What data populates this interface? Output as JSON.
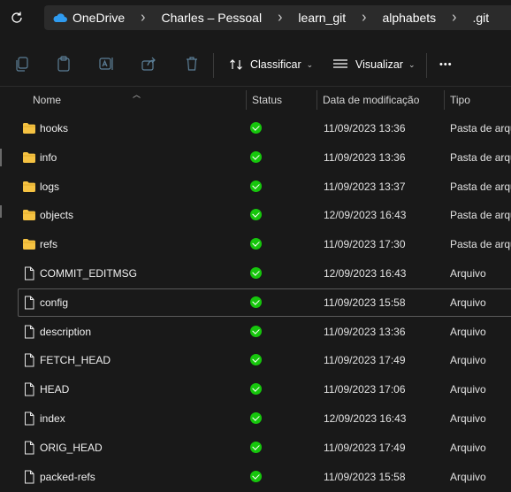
{
  "address_bar": {
    "crumbs": [
      {
        "label": "OneDrive"
      },
      {
        "label": "Charles – Pessoal"
      },
      {
        "label": "learn_git"
      },
      {
        "label": "alphabets"
      },
      {
        "label": ".git"
      }
    ]
  },
  "toolbar": {
    "sort_label": "Classificar",
    "view_label": "Visualizar",
    "more_label": "•••"
  },
  "columns": {
    "name": "Nome",
    "status": "Status",
    "modified": "Data de modificação",
    "type": "Tipo"
  },
  "files": [
    {
      "name": "hooks",
      "kind": "folder",
      "modified": "11/09/2023 13:36",
      "type": "Pasta de arquivos"
    },
    {
      "name": "info",
      "kind": "folder",
      "modified": "11/09/2023 13:36",
      "type": "Pasta de arquivos"
    },
    {
      "name": "logs",
      "kind": "folder",
      "modified": "11/09/2023 13:37",
      "type": "Pasta de arquivos"
    },
    {
      "name": "objects",
      "kind": "folder",
      "modified": "12/09/2023 16:43",
      "type": "Pasta de arquivos"
    },
    {
      "name": "refs",
      "kind": "folder",
      "modified": "11/09/2023 17:30",
      "type": "Pasta de arquivos"
    },
    {
      "name": "COMMIT_EDITMSG",
      "kind": "file",
      "modified": "12/09/2023 16:43",
      "type": "Arquivo"
    },
    {
      "name": "config",
      "kind": "file",
      "modified": "11/09/2023 15:58",
      "type": "Arquivo",
      "selected": true
    },
    {
      "name": "description",
      "kind": "file",
      "modified": "11/09/2023 13:36",
      "type": "Arquivo"
    },
    {
      "name": "FETCH_HEAD",
      "kind": "file",
      "modified": "11/09/2023 17:49",
      "type": "Arquivo"
    },
    {
      "name": "HEAD",
      "kind": "file",
      "modified": "11/09/2023 17:06",
      "type": "Arquivo"
    },
    {
      "name": "index",
      "kind": "file",
      "modified": "12/09/2023 16:43",
      "type": "Arquivo"
    },
    {
      "name": "ORIG_HEAD",
      "kind": "file",
      "modified": "11/09/2023 17:49",
      "type": "Arquivo"
    },
    {
      "name": "packed-refs",
      "kind": "file",
      "modified": "11/09/2023 15:58",
      "type": "Arquivo"
    }
  ],
  "colors": {
    "background": "#191919",
    "folder": "#f5c242",
    "status_ok": "#16c60c",
    "onedrive": "#2f9bf0"
  },
  "icons": {
    "status": "synced-check-icon",
    "folder": "folder-icon",
    "file": "file-icon"
  }
}
